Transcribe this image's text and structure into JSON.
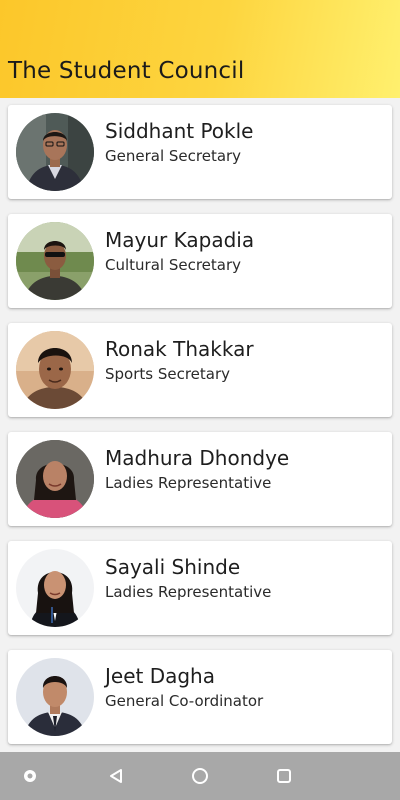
{
  "header": {
    "title": "The Student Council"
  },
  "members": [
    {
      "name": "Siddhant Pokle",
      "role": "General Secretary"
    },
    {
      "name": "Mayur Kapadia",
      "role": "Cultural Secretary"
    },
    {
      "name": "Ronak Thakkar",
      "role": "Sports Secretary"
    },
    {
      "name": "Madhura Dhondye",
      "role": "Ladies Representative"
    },
    {
      "name": "Sayali Shinde",
      "role": "Ladies Representative"
    },
    {
      "name": "Jeet Dagha",
      "role": "General Co-ordinator"
    }
  ],
  "navbar": {
    "icons": [
      "record-icon",
      "back-triangle-icon",
      "home-circle-icon",
      "recents-square-icon"
    ]
  },
  "colors": {
    "header_gradient_start": "#fcc72a",
    "header_gradient_end": "#fff06e",
    "navbar": "#a8a8a8",
    "card": "#ffffff"
  }
}
